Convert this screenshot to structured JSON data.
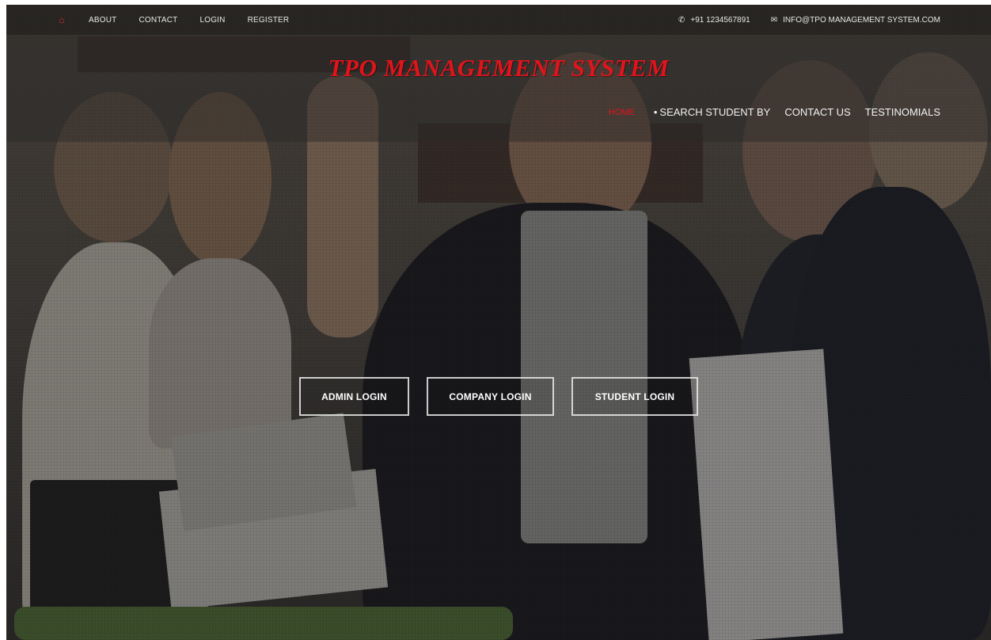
{
  "topbar": {
    "home_icon": "home-icon",
    "nav": [
      "ABOUT",
      "CONTACT",
      "LOGIN",
      "REGISTER"
    ],
    "phone_icon": "phone-icon",
    "phone": "+91 1234567891",
    "email_icon": "envelope-icon",
    "email": "INFO@TPO MANAGEMENT SYSTEM.COM"
  },
  "header": {
    "brand": "TPO MANAGEMENT SYSTEM",
    "brand_color": "#e1141c",
    "nav": {
      "home": "HOME",
      "search": "SEARCH STUDENT BY",
      "contact": "CONTACT US",
      "testimonials": "TESTINOMIALS"
    }
  },
  "logins": {
    "admin": "ADMIN LOGIN",
    "company": "COMPANY LOGIN",
    "student": "STUDENT LOGIN"
  }
}
